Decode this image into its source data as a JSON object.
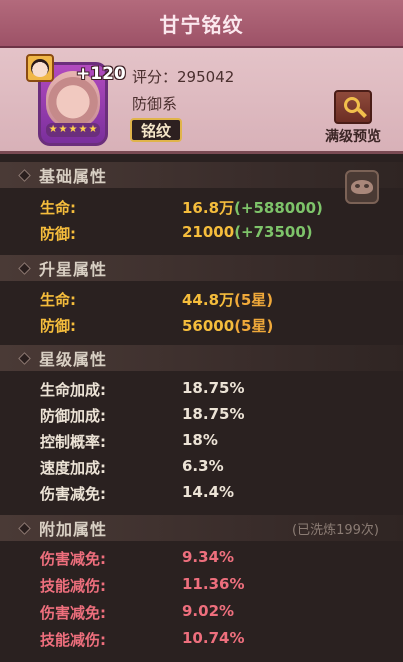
{
  "title": "甘宁铭纹",
  "header": {
    "plus_level": "+120",
    "score_label": "评分：",
    "score_value": "295042",
    "type": "防御系",
    "tag": "铭纹",
    "stars": 5,
    "preview_label": "满级预览"
  },
  "sections": {
    "base": {
      "title": "基础属性",
      "rows": [
        {
          "label": "生命:",
          "value": "16.8万",
          "bonus": "(+588000)"
        },
        {
          "label": "防御:",
          "value": "21000",
          "bonus": "(+73500)"
        }
      ]
    },
    "star_up": {
      "title": "升星属性",
      "rows": [
        {
          "label": "生命:",
          "value": "44.8万",
          "star": "(5星)"
        },
        {
          "label": "防御:",
          "value": "56000",
          "star": "(5星)"
        }
      ]
    },
    "level": {
      "title": "星级属性",
      "rows": [
        {
          "label": "生命加成:",
          "value": "18.75%"
        },
        {
          "label": "防御加成:",
          "value": "18.75%"
        },
        {
          "label": "控制概率:",
          "value": "18%"
        },
        {
          "label": "速度加成:",
          "value": "6.3%"
        },
        {
          "label": "伤害减免:",
          "value": "14.4%"
        }
      ]
    },
    "extra": {
      "title": "附加属性",
      "note": "(已洗炼199次)",
      "rows": [
        {
          "label": "伤害减免:",
          "value": "9.34%"
        },
        {
          "label": "技能减伤:",
          "value": "11.36%"
        },
        {
          "label": "伤害减免:",
          "value": "9.02%"
        },
        {
          "label": "技能减伤:",
          "value": "10.74%"
        }
      ]
    }
  },
  "colors": {
    "title_bar": "#a85c70",
    "bonus_green": "#7ec46a",
    "star_orange": "#f0a93a",
    "extra_pink": "#ee6f7d",
    "base_gold": "#f5bd3c"
  }
}
